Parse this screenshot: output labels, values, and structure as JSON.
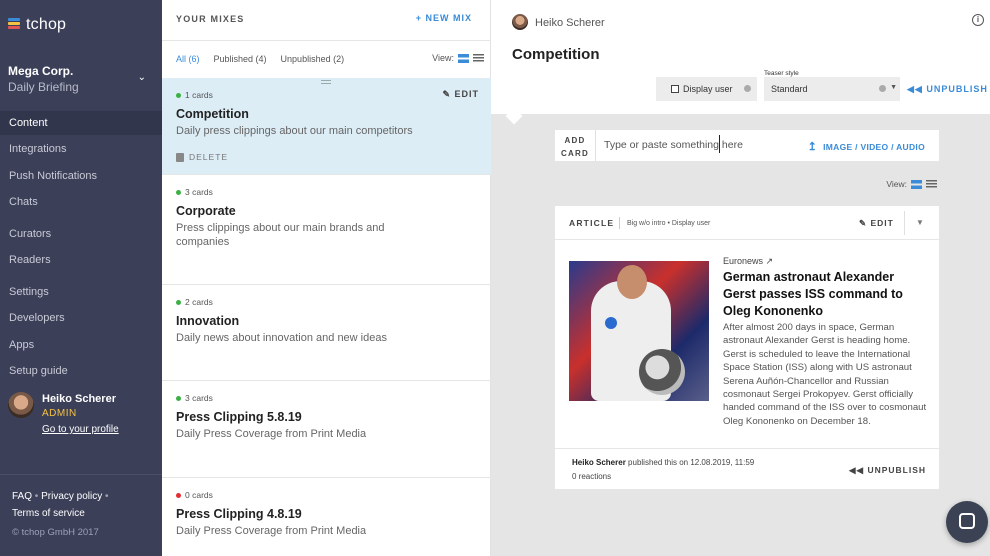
{
  "app": {
    "logo_text": "tchop",
    "logo_colors": [
      "#3a8bd8",
      "#f5c242",
      "#e25555"
    ]
  },
  "org": {
    "name": "Mega Corp.",
    "subtitle": "Daily Briefing"
  },
  "nav": [
    {
      "label": "Content",
      "active": true
    },
    {
      "label": "Integrations"
    },
    {
      "label": "Push Notifications"
    },
    {
      "label": "Chats"
    },
    {
      "label": "Curators"
    },
    {
      "label": "Readers"
    },
    {
      "label": "Settings"
    },
    {
      "label": "Developers"
    },
    {
      "label": "Apps"
    },
    {
      "label": "Setup guide"
    }
  ],
  "profile": {
    "name": "Heiko Scherer",
    "role": "ADMIN",
    "link": "Go to your profile"
  },
  "footer": {
    "faq": "FAQ",
    "privacy": "Privacy policy",
    "sep": "•",
    "terms": "Terms of service",
    "copyright": "© tchop GmbH 2017"
  },
  "mixes": {
    "header": "YOUR MIXES",
    "new_mix": "+ NEW MIX",
    "filters": [
      "All (6)",
      "Published (4)",
      "Unpublished (2)"
    ],
    "view_label": "View:",
    "items": [
      {
        "count": "1 cards",
        "title": "Competition",
        "desc": "Daily press clippings about our main competitors",
        "status_color": "#3cb043",
        "edit": "EDIT",
        "delete": "DELETE"
      },
      {
        "count": "3 cards",
        "title": "Corporate",
        "desc": "Press clippings about our main brands and companies",
        "status_color": "#3cb043"
      },
      {
        "count": "2 cards",
        "title": "Innovation",
        "desc": "Daily news about innovation and new ideas",
        "status_color": "#3cb043"
      },
      {
        "count": "3 cards",
        "title": "Press Clipping 5.8.19",
        "desc": "Daily Press Coverage from Print Media",
        "status_color": "#3cb043"
      },
      {
        "count": "0 cards",
        "title": "Press Clipping 4.8.19",
        "desc": "Daily Press Coverage from Print Media",
        "status_color": "#e03030"
      }
    ]
  },
  "editor": {
    "user": "Heiko Scherer",
    "title": "Competition",
    "info_icon": "i",
    "display_user": "Display user",
    "teaser_label": "Teaser style",
    "teaser_value": "Standard",
    "unpublish": "UNPUBLISH",
    "add_card_label_1": "ADD",
    "add_card_label_2": "CARD",
    "add_placeholder": "Type or paste something here",
    "add_media": "IMAGE / VIDEO / AUDIO",
    "view_label": "View:",
    "article": {
      "type": "ARTICLE",
      "meta": "Big w/o intro • Display user",
      "edit": "EDIT",
      "source": "Euronews ↗",
      "title": "German astronaut Alexander Gerst passes ISS command to Oleg Kononenko",
      "body": "After almost 200 days in space, German astronaut Alexander Gerst is heading home. Gerst is scheduled to leave the International Space Station (ISS) along with US astronaut Serena Auñón-Chancellor and Russian cosmonaut Sergei Prokopyev. Gerst officially handed command of the ISS over to cosmonaut Oleg Kononenko on December 18.",
      "author": "Heiko Scherer",
      "published": "published this on 12.08.2019, 11:59",
      "reactions": "0 reactions",
      "unpublish": "UNPUBLISH"
    }
  }
}
